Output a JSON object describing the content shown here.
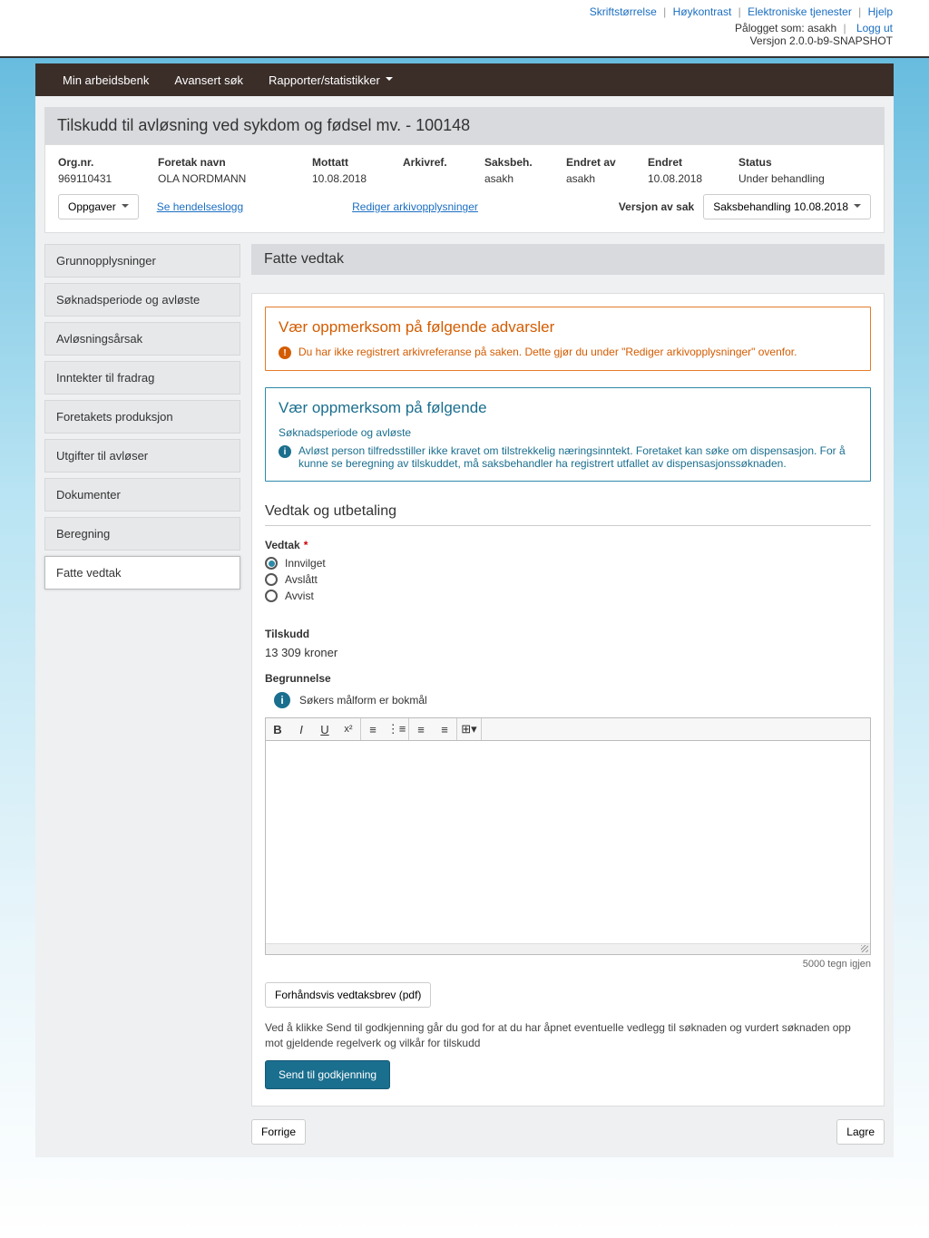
{
  "header": {
    "links": [
      "Skriftstørrelse",
      "Høykontrast",
      "Elektroniske tjenester",
      "Hjelp"
    ],
    "logged_in_prefix": "Pålogget som:",
    "user": "asakh",
    "logout": "Logg ut",
    "version": "Versjon 2.0.0-b9-SNAPSHOT"
  },
  "nav": {
    "items": [
      "Min arbeidsbenk",
      "Avansert søk",
      "Rapporter/statistikker"
    ]
  },
  "case": {
    "title": "Tilskudd til avløsning ved sykdom og fødsel mv. - 100148",
    "fields": {
      "orgnr_label": "Org.nr.",
      "orgnr": "969110431",
      "foretak_label": "Foretak navn",
      "foretak": "OLA NORDMANN",
      "mottatt_label": "Mottatt",
      "mottatt": "10.08.2018",
      "arkivref_label": "Arkivref.",
      "arkivref": "",
      "saksbeh_label": "Saksbeh.",
      "saksbeh": "asakh",
      "endret_av_label": "Endret av",
      "endret_av": "asakh",
      "endret_label": "Endret",
      "endret": "10.08.2018",
      "status_label": "Status",
      "status": "Under behandling"
    },
    "actions": {
      "oppgaver": "Oppgaver",
      "hendelseslogg": "Se hendelseslogg",
      "rediger_arkiv": "Rediger arkivopplysninger",
      "versjon_label": "Versjon av sak",
      "versjon_value": "Saksbehandling 10.08.2018"
    }
  },
  "sidebar": {
    "items": [
      "Grunnopplysninger",
      "Søknadsperiode og avløste",
      "Avløsningsårsak",
      "Inntekter til fradrag",
      "Foretakets produksjon",
      "Utgifter til avløser",
      "Dokumenter",
      "Beregning",
      "Fatte vedtak"
    ],
    "active_index": 8
  },
  "main": {
    "heading": "Fatte vedtak",
    "warning": {
      "title": "Vær oppmerksom på følgende advarsler",
      "msg": "Du har ikke registrert arkivreferanse på saken. Dette gjør du under \"Rediger arkivopplysninger\" ovenfor."
    },
    "info": {
      "title": "Vær oppmerksom på følgende",
      "subtitle": "Søknadsperiode og avløste",
      "msg": "Avløst person tilfredsstiller ikke kravet om tilstrekkelig næringsinntekt. Foretaket kan søke om dispensasjon. For å kunne se beregning av tilskuddet, må saksbehandler ha registrert utfallet av dispensasjonssøknaden."
    },
    "section": "Vedtak og utbetaling",
    "vedtak": {
      "label": "Vedtak",
      "options": [
        "Innvilget",
        "Avslått",
        "Avvist"
      ],
      "selected": "Innvilget"
    },
    "tilskudd": {
      "label": "Tilskudd",
      "value": "13 309 kroner"
    },
    "begrunnelse": {
      "label": "Begrunnelse",
      "info": "Søkers målform er bokmål",
      "char_count": "5000 tegn igjen"
    },
    "preview_btn": "Forhåndsvis vedtaksbrev (pdf)",
    "disclaimer": "Ved å klikke Send til godkjenning går du god for at du har åpnet eventuelle vedlegg til søknaden og vurdert søknaden opp mot gjeldende regelverk og vilkår for tilskudd",
    "send_btn": "Send til godkjenning",
    "prev_btn": "Forrige",
    "save_btn": "Lagre"
  }
}
